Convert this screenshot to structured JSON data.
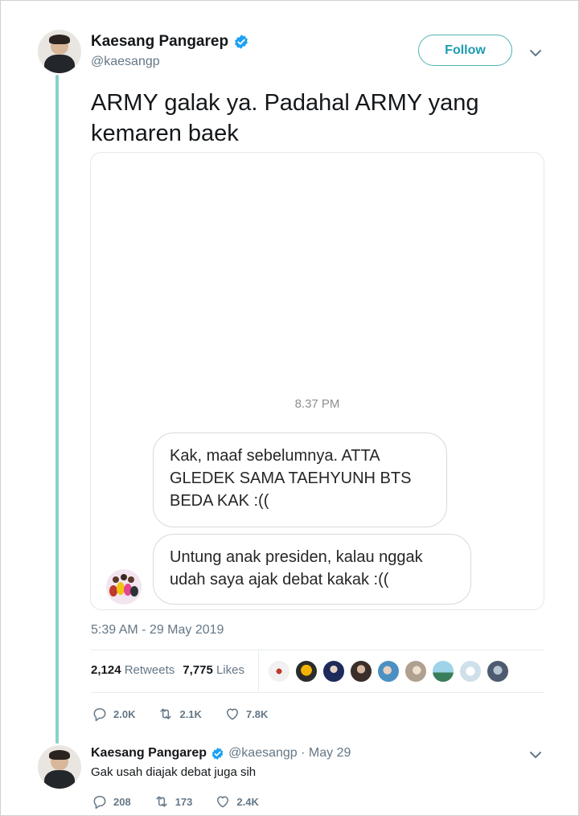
{
  "tweet": {
    "author_name": "Kaesang Pangarep",
    "author_handle": "@kaesangp",
    "follow_label": "Follow",
    "text": "ARMY galak ya. Padahal ARMY yang kemaren baek",
    "timestamp": "5:39 AM - 29 May 2019",
    "retweets_count": "2,124",
    "retweets_label": "Retweets",
    "likes_count": "7,775",
    "likes_label": "Likes",
    "actions": {
      "replies": "2.0K",
      "retweets": "2.1K",
      "likes": "7.8K"
    }
  },
  "media": {
    "message_time": "8.37 PM",
    "messages": [
      "Kak, maaf sebelumnya. ATTA GLEDEK SAMA TAEHYUNH BTS BEDA KAK :((",
      "Untung anak presiden, kalau nggak udah saya ajak debat kakak :(("
    ]
  },
  "reply": {
    "author_name": "Kaesang Pangarep",
    "meta": "@kaesangp · May 29",
    "text": "Gak usah diajak debat juga sih",
    "actions": {
      "replies": "208",
      "retweets": "173",
      "likes": "2.4K"
    }
  },
  "colors": {
    "accent": "#1d9bb0",
    "thread_line": "#8ad2cc",
    "verified": "#1da1f2",
    "muted": "#657786"
  }
}
